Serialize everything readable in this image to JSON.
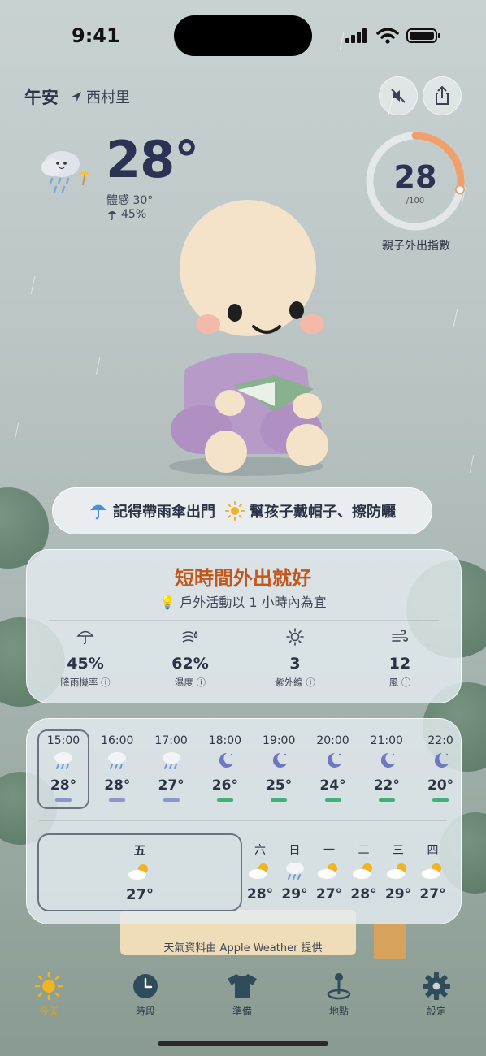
{
  "status": {
    "time": "9:41"
  },
  "header": {
    "greeting": "午安",
    "location": "西村里",
    "mute_icon": "speaker-muted-icon",
    "share_icon": "share-icon"
  },
  "current": {
    "temperature": "28°",
    "feels_like": "體感 30°",
    "rain_prob": "45%",
    "icon": "rain-cloud-icon"
  },
  "index": {
    "value": "28",
    "max": "/100",
    "label": "親子外出指數",
    "fraction": 0.28,
    "accent": "#f1a06b"
  },
  "tips": [
    {
      "icon": "umbrella-icon",
      "text": "記得帶雨傘出門"
    },
    {
      "icon": "sun-icon",
      "text": "幫孩子戴帽子、擦防曬"
    }
  ],
  "advice": {
    "title": "短時間外出就好",
    "subtitle": "戶外活動以 1 小時內為宜",
    "stats": [
      {
        "icon": "umbrella-icon",
        "value": "45%",
        "label": "降雨機率 ⓘ"
      },
      {
        "icon": "humidity-icon",
        "value": "62%",
        "label": "濕度 ⓘ"
      },
      {
        "icon": "sun-icon",
        "value": "3",
        "label": "紫外線 ⓘ"
      },
      {
        "icon": "wind-icon",
        "value": "12",
        "label": "風 ⓘ"
      }
    ]
  },
  "hourly": [
    {
      "time": "15:00",
      "temp": "28°",
      "icon": "rain-icon",
      "bar": "#8a97c9"
    },
    {
      "time": "16:00",
      "temp": "28°",
      "icon": "rain-icon",
      "bar": "#8a97c9"
    },
    {
      "time": "17:00",
      "temp": "27°",
      "icon": "rain-icon",
      "bar": "#8a97c9"
    },
    {
      "time": "18:00",
      "temp": "26°",
      "icon": "moon-icon",
      "bar": "#3fb07a"
    },
    {
      "time": "19:00",
      "temp": "25°",
      "icon": "moon-icon",
      "bar": "#3fb07a"
    },
    {
      "time": "20:00",
      "temp": "24°",
      "icon": "moon-icon",
      "bar": "#3fb07a"
    },
    {
      "time": "21:00",
      "temp": "22°",
      "icon": "moon-icon",
      "bar": "#3fb07a"
    },
    {
      "time": "22:0",
      "temp": "20°",
      "icon": "moon-icon",
      "bar": "#3fb07a"
    }
  ],
  "daily_selected": {
    "day": "五",
    "temp": "27°",
    "icon": "partly-sunny-icon"
  },
  "daily": [
    {
      "day": "六",
      "temp": "28°",
      "icon": "partly-sunny-icon"
    },
    {
      "day": "日",
      "temp": "29°",
      "icon": "rain-icon"
    },
    {
      "day": "一",
      "temp": "27°",
      "icon": "partly-sunny-icon"
    },
    {
      "day": "二",
      "temp": "28°",
      "icon": "partly-sunny-icon"
    },
    {
      "day": "三",
      "temp": "29°",
      "icon": "partly-sunny-icon"
    },
    {
      "day": "四",
      "temp": "27°",
      "icon": "partly-sunny-icon"
    }
  ],
  "credit": "天氣資料由 Apple Weather 提供",
  "tabs": [
    {
      "label": "今天",
      "icon": "sun-icon",
      "active": true
    },
    {
      "label": "時段",
      "icon": "clock-icon"
    },
    {
      "label": "準備",
      "icon": "tshirt-icon"
    },
    {
      "label": "地點",
      "icon": "map-pin-icon"
    },
    {
      "label": "設定",
      "icon": "gear-icon"
    }
  ],
  "colors": {
    "accent_orange": "#c0571d",
    "tab_active": "#f0b323",
    "tab_inactive": "#2f4b5c"
  }
}
